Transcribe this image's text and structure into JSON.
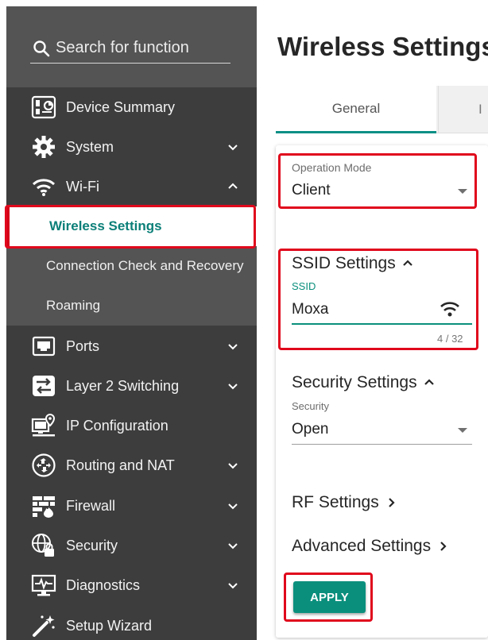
{
  "search": {
    "placeholder": "Search for function"
  },
  "sidebar": {
    "items": [
      {
        "label": "Device Summary",
        "icon": "device-summary-icon"
      },
      {
        "label": "System",
        "icon": "gear-icon",
        "chevron": "down"
      },
      {
        "label": "Wi-Fi",
        "icon": "wifi-icon",
        "chevron": "up"
      },
      {
        "label": "Ports",
        "icon": "ethernet-port-icon",
        "chevron": "down"
      },
      {
        "label": "Layer 2 Switching",
        "icon": "switching-icon",
        "chevron": "down"
      },
      {
        "label": "IP Configuration",
        "icon": "ip-config-icon"
      },
      {
        "label": "Routing and NAT",
        "icon": "routing-icon",
        "chevron": "down"
      },
      {
        "label": "Firewall",
        "icon": "firewall-icon",
        "chevron": "down"
      },
      {
        "label": "Security",
        "icon": "globe-lock-icon",
        "chevron": "down"
      },
      {
        "label": "Diagnostics",
        "icon": "monitor-pulse-icon",
        "chevron": "down"
      },
      {
        "label": "Setup Wizard",
        "icon": "wand-icon"
      }
    ],
    "wifi_subitems": [
      {
        "label": "Wireless Settings",
        "active": true
      },
      {
        "label": "Connection Check and Recovery"
      },
      {
        "label": "Roaming"
      }
    ]
  },
  "main": {
    "title": "Wireless Settings",
    "tabs": [
      {
        "label": "General",
        "active": true
      },
      {
        "label": "I"
      }
    ],
    "operation_mode": {
      "label": "Operation Mode",
      "value": "Client"
    },
    "ssid_section": {
      "title": "SSID Settings",
      "field_label": "SSID",
      "value": "Moxa",
      "counter": "4 / 32"
    },
    "security_section": {
      "title": "Security Settings",
      "field_label": "Security",
      "value": "Open"
    },
    "rf_settings": "RF Settings",
    "advanced_settings": "Advanced Settings",
    "apply_label": "APPLY"
  },
  "colors": {
    "accent": "#0b8f7d",
    "highlight_box": "#e0081c",
    "sidebar_bg": "#3d3d3d",
    "sidebar_search_bg": "#545454",
    "active_text": "#0b7f78"
  }
}
